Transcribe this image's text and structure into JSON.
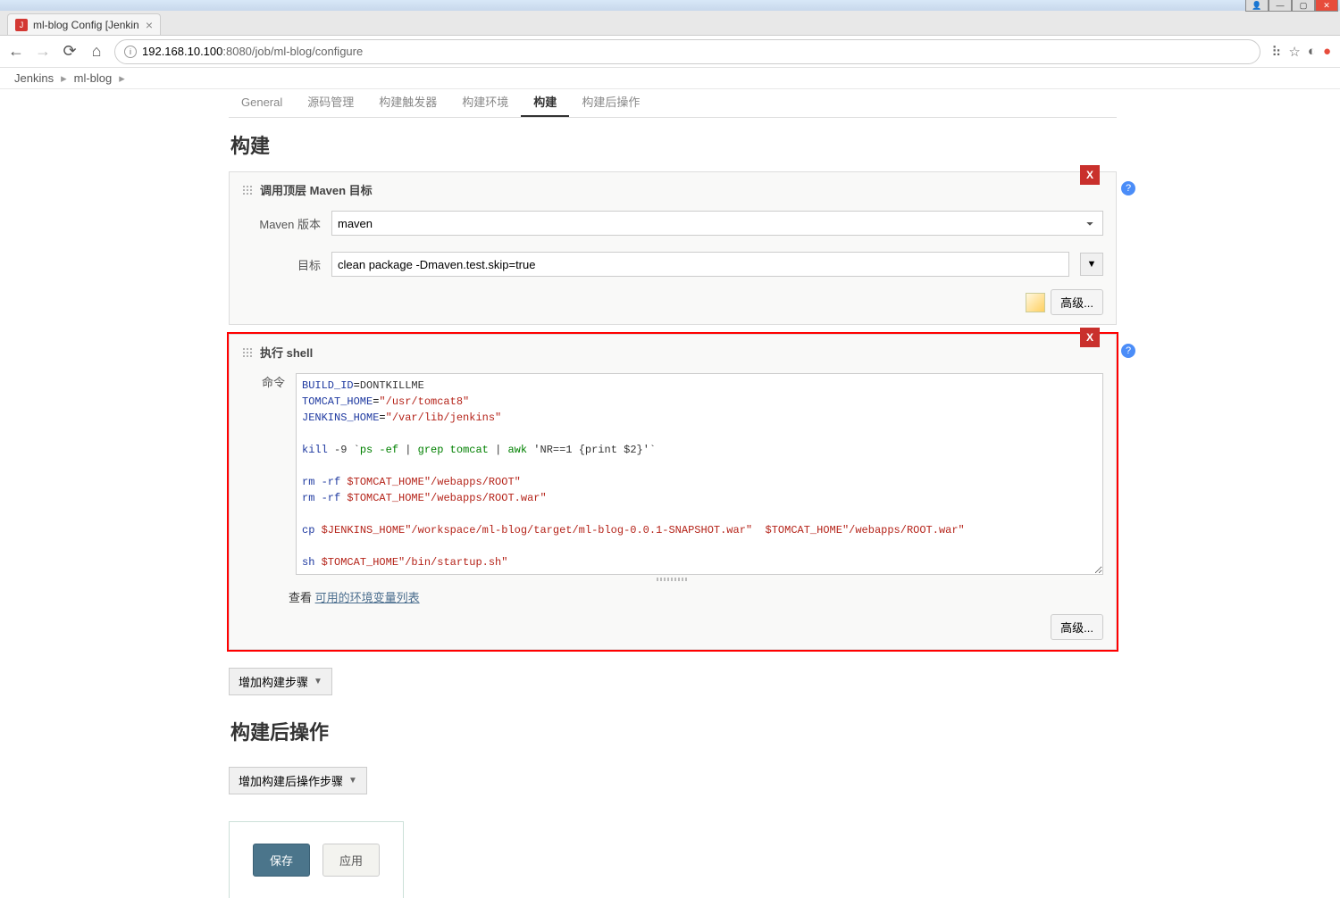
{
  "browser": {
    "tab_title": "ml-blog Config [Jenkin",
    "url_host": "192.168.10.100",
    "url_port": ":8080",
    "url_path": "/job/ml-blog/configure"
  },
  "breadcrumb": {
    "items": [
      "Jenkins",
      "ml-blog"
    ]
  },
  "tabs": {
    "items": [
      {
        "label": "General"
      },
      {
        "label": "源码管理"
      },
      {
        "label": "构建触发器"
      },
      {
        "label": "构建环境"
      },
      {
        "label": "构建"
      },
      {
        "label": "构建后操作"
      }
    ],
    "active_index": 4
  },
  "section_build": "构建",
  "maven_block": {
    "title": "调用顶层 Maven 目标",
    "version_label": "Maven 版本",
    "version_value": "maven",
    "goals_label": "目标",
    "goals_value": "clean package -Dmaven.test.skip=true",
    "advanced": "高级..."
  },
  "shell_block": {
    "title": "执行 shell",
    "cmd_label": "命令",
    "look_prefix": "查看 ",
    "look_link": "可用的环境变量列表",
    "advanced": "高级...",
    "script": {
      "l1a": "BUILD_ID",
      "l1b": "=",
      "l1c": "DONTKILLME",
      "l2a": "TOMCAT_HOME",
      "l2b": "=",
      "l2c": "\"/usr/tomcat8\"",
      "l3a": "JENKINS_HOME",
      "l3b": "=",
      "l3c": "\"/var/lib/jenkins\"",
      "l5a": "kill",
      "l5b": " -9 `",
      "l5c": "ps -ef",
      "l5d": " | ",
      "l5e": "grep tomcat",
      "l5f": " | ",
      "l5g": "awk",
      "l5h": " 'NR==1 {print $2}'`",
      "l7a": "rm -rf ",
      "l7b": "$TOMCAT_HOME",
      "l7c": "\"/webapps/ROOT\"",
      "l8a": "rm -rf ",
      "l8b": "$TOMCAT_HOME",
      "l8c": "\"/webapps/ROOT.war\"",
      "l10a": "cp ",
      "l10b": "$JENKINS_HOME",
      "l10c": "\"/workspace/ml-blog/target/ml-blog-0.0.1-SNAPSHOT.war\"",
      "l10d": "  ",
      "l10e": "$TOMCAT_HOME",
      "l10f": "\"/webapps/ROOT.war\"",
      "l12a": "sh ",
      "l12b": "$TOMCAT_HOME",
      "l12c": "\"/bin/startup.sh\""
    }
  },
  "add_build_step": "增加构建步骤",
  "section_postbuild": "构建后操作",
  "add_postbuild": "增加构建后操作步骤",
  "save": "保存",
  "apply": "应用"
}
